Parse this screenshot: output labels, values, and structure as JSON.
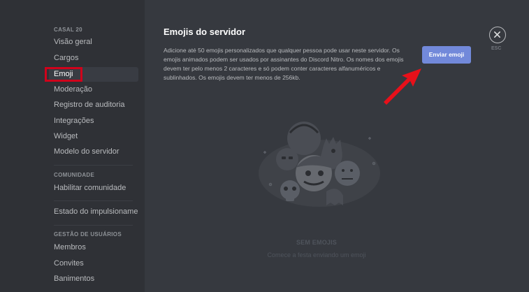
{
  "sidebar": {
    "sections": [
      {
        "header": "CASAL 20",
        "items": [
          "Visão geral",
          "Cargos",
          "Emoji",
          "Moderação",
          "Registro de auditoria",
          "Integrações",
          "Widget",
          "Modelo do servidor"
        ]
      },
      {
        "header": "COMUNIDADE",
        "items": [
          "Habilitar comunidade"
        ]
      },
      {
        "header": "",
        "items": [
          "Estado do impulsionamento"
        ]
      },
      {
        "header": "GESTÃO DE USUÁRIOS",
        "items": [
          "Membros",
          "Convites",
          "Banimentos"
        ]
      }
    ],
    "selected": "Emoji"
  },
  "main": {
    "title": "Emojis do servidor",
    "description": "Adicione até 50 emojis personalizados que qualquer pessoa pode usar neste servidor. Os emojis animados podem ser usados por assinantes do Discord Nitro. Os nomes dos emojis devem ter pelo menos 2 caracteres e só podem conter caracteres alfanuméricos e sublinhados. Os emojis devem ter menos de 256kb.",
    "upload_button": "Enviar emoji",
    "close_label": "ESC",
    "empty_title": "SEM EMOJIS",
    "empty_subtitle": "Comece a festa enviando um emoji"
  },
  "colors": {
    "sidebar_bg": "#2f3136",
    "content_bg": "#36393f",
    "accent": "#7289da",
    "highlight_box": "#d0021b",
    "arrow": "#e8101a"
  },
  "icons": {
    "close": "close-icon",
    "arrow": "red-arrow-annotation",
    "illustration": "empty-emoji-illustration"
  }
}
